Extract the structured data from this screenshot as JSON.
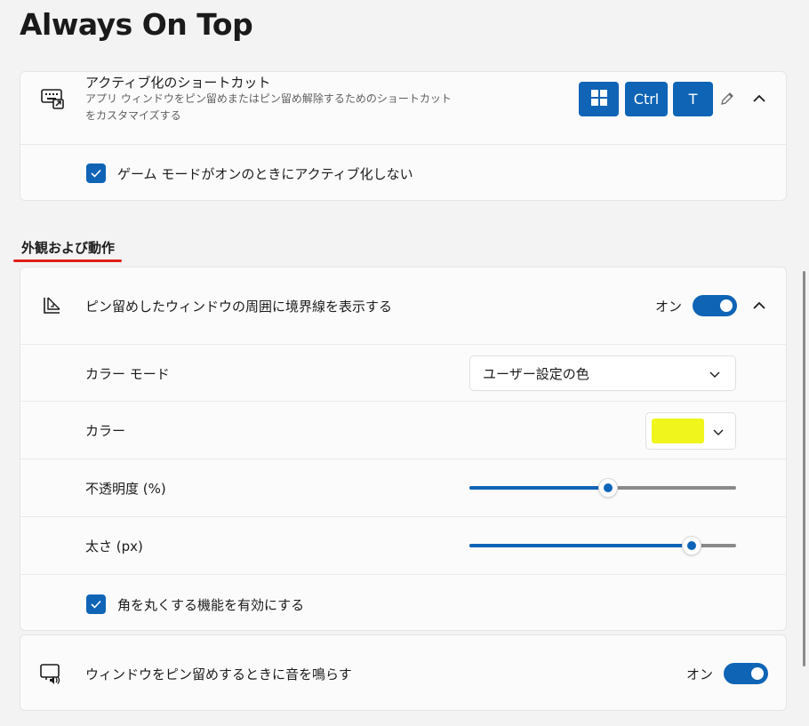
{
  "page": {
    "title": "Always On Top"
  },
  "shortcut_card": {
    "icon": "keyboard-shortcut-icon",
    "title": "アクティブ化のショートカット",
    "description_line1": "アプリ ウィンドウをピン留めまたはピン留め解除するためのショートカット",
    "description_line2": "をカスタマイズする",
    "keys": {
      "win_icon": "windows-logo-icon",
      "ctrl": "Ctrl",
      "t": "T"
    },
    "edit_icon": "pencil-icon",
    "expand_icon": "chevron-up-icon",
    "game_mode_checkbox": {
      "label": "ゲーム モードがオンのときにアクティブ化しない",
      "checked": true
    }
  },
  "section": {
    "title": "外観および動作"
  },
  "border_card": {
    "icon": "pinned-window-border-icon",
    "title": "ピン留めしたウィンドウの周囲に境界線を表示する",
    "toggle_label": "オン",
    "toggle_on": true,
    "color_mode": {
      "label": "カラー モード",
      "value": "ユーザー設定の色"
    },
    "color": {
      "label": "カラー",
      "swatch": "#f0f51b"
    },
    "opacity": {
      "label": "不透明度 (%)",
      "value_fraction": 0.52
    },
    "thickness": {
      "label": "太さ (px)",
      "value_fraction": 0.83
    },
    "rounded_corners": {
      "label": "角を丸くする機能を有効にする",
      "checked": true
    }
  },
  "sound_card": {
    "icon": "window-sound-icon",
    "title": "ウィンドウをピン留めするときに音を鳴らす",
    "toggle_label": "オン",
    "toggle_on": true
  },
  "colors": {
    "accent": "#0f64b6",
    "background": "#f3f3f3",
    "card": "#fbfbfb",
    "highlight": "#e0201c"
  }
}
